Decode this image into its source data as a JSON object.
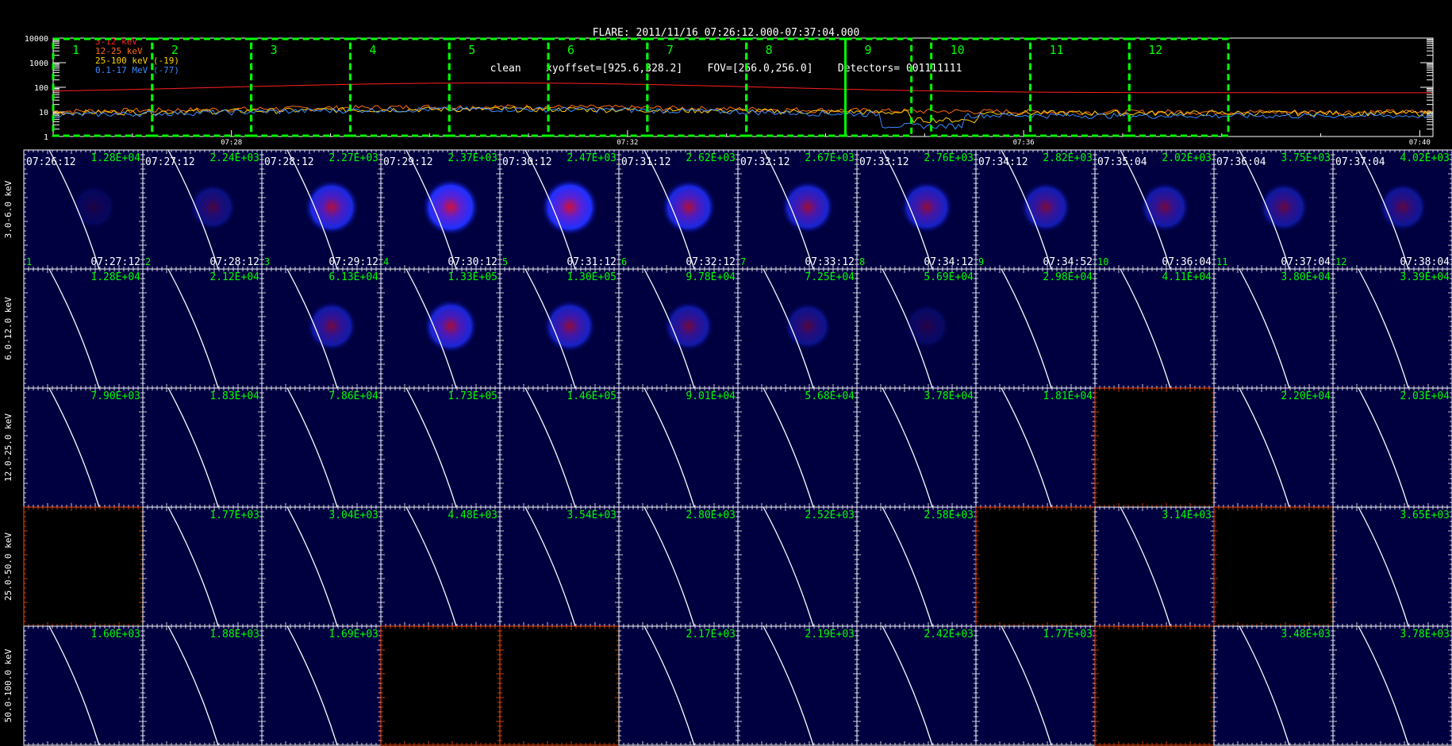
{
  "header": {
    "title": "FLARE: 2011/11/16 07:26:12.000-07:37:04.000",
    "params": "clean    xyoffset=[925.6,328.2]    FOV=[256.0,256.0]    Detectors= 001111111"
  },
  "lightcurve": {
    "yticks": [
      "10000",
      "1000",
      "100",
      "10",
      "1"
    ],
    "legend": [
      {
        "label": "3-12 keV",
        "color": "#ff2020"
      },
      {
        "label": "12-25 keV",
        "color": "#ff6a10"
      },
      {
        "label": "25-100 keV (-19)",
        "color": "#ffd000"
      },
      {
        "label": "0.1-17 MeV (-77)",
        "color": "#3a8aff"
      }
    ],
    "xticks": [
      "07:28",
      "07:32",
      "07:36",
      "07:40"
    ],
    "interval_labels": [
      "1",
      "2",
      "3",
      "4",
      "5",
      "6",
      "7",
      "8",
      "9",
      "10",
      "11",
      "12"
    ],
    "interval_color": "#00ff00",
    "log_scale": true,
    "series": [
      {
        "name": "3-12 keV",
        "level": 60,
        "bump": 90
      },
      {
        "name": "12-25 keV",
        "level": 10,
        "bump": 6
      },
      {
        "name": "25-100 keV (-19)",
        "level": 9,
        "bump": 4
      },
      {
        "name": "0.1-17 MeV (-77)",
        "level": 7,
        "bump": 6
      }
    ]
  },
  "energy_bands": [
    "3.0-6.0 keV",
    "6.0-12.0 keV",
    "12.0-25.0 keV",
    "25.0-50.0 keV",
    "50.0-100.0 keV"
  ],
  "columns": [
    {
      "start": "07:26:12",
      "end": "07:27:12",
      "index": "1"
    },
    {
      "start": "07:27:12",
      "end": "07:28:12",
      "index": "2"
    },
    {
      "start": "07:28:12",
      "end": "07:29:12",
      "index": "3"
    },
    {
      "start": "07:29:12",
      "end": "07:30:12",
      "index": "4"
    },
    {
      "start": "07:30:12",
      "end": "07:31:12",
      "index": "5"
    },
    {
      "start": "07:31:12",
      "end": "07:32:12",
      "index": "6"
    },
    {
      "start": "07:32:12",
      "end": "07:33:12",
      "index": "7"
    },
    {
      "start": "07:33:12",
      "end": "07:34:12",
      "index": "8"
    },
    {
      "start": "07:34:12",
      "end": "07:34:52",
      "index": "9"
    },
    {
      "start": "07:35:04",
      "end": "07:36:04",
      "index": "10"
    },
    {
      "start": "07:36:04",
      "end": "07:37:04",
      "index": "11"
    },
    {
      "start": "07:37:04",
      "end": "07:38:04",
      "index": "12"
    }
  ],
  "max_values": [
    [
      "1.28E+04",
      "2.24E+03",
      "2.27E+03",
      "2.37E+03",
      "2.47E+03",
      "2.62E+03",
      "2.67E+03",
      "2.76E+03",
      "2.82E+03",
      "2.02E+03",
      "3.75E+03",
      "4.02E+03"
    ],
    [
      "1.28E+04",
      "2.12E+04",
      "6.13E+04",
      "1.33E+05",
      "1.30E+05",
      "9.78E+04",
      "7.25E+04",
      "5.69E+04",
      "2.98E+04",
      "4.11E+04",
      "3.80E+04",
      "3.39E+04"
    ],
    [
      "7.90E+03",
      "1.83E+04",
      "7.86E+04",
      "1.73E+05",
      "1.46E+05",
      "9.01E+04",
      "5.68E+04",
      "3.78E+04",
      "1.81E+04",
      "",
      "2.20E+04",
      "2.03E+04"
    ],
    [
      "",
      "1.77E+03",
      "3.04E+03",
      "4.48E+03",
      "3.54E+03",
      "2.80E+03",
      "2.52E+03",
      "2.58E+03",
      "",
      "3.14E+03",
      "",
      "3.65E+03"
    ],
    [
      "1.60E+03",
      "1.88E+03",
      "1.69E+03",
      "",
      "",
      "2.17E+03",
      "2.19E+03",
      "2.42E+03",
      "1.77E+03",
      "",
      "3.48E+03",
      "3.78E+03"
    ]
  ],
  "source_intensity": [
    [
      0.15,
      0.35,
      0.85,
      1.0,
      1.0,
      0.85,
      0.75,
      0.7,
      0.6,
      0.55,
      0.5,
      0.45
    ],
    [
      0,
      0,
      0.55,
      0.8,
      0.7,
      0.55,
      0.4,
      0.2,
      0,
      0,
      0,
      0
    ],
    [
      0,
      0,
      0,
      0,
      0,
      0,
      0,
      0,
      0,
      0,
      0,
      0
    ],
    [
      0,
      0,
      0,
      0,
      0,
      0,
      0,
      0,
      0,
      0,
      0,
      0
    ],
    [
      0,
      0,
      0,
      0,
      0,
      0,
      0,
      0,
      0,
      0,
      0,
      0
    ]
  ],
  "empty_cells": [
    [
      2,
      9
    ],
    [
      3,
      0
    ],
    [
      3,
      8
    ],
    [
      3,
      10
    ],
    [
      4,
      3
    ],
    [
      4,
      4
    ],
    [
      4,
      9
    ]
  ],
  "colors": {
    "value_text": "#00ff00",
    "frame_empty": "#ff4a00",
    "limb": "#ffffff",
    "map_bg": "#000040",
    "source": "#1030ff"
  }
}
